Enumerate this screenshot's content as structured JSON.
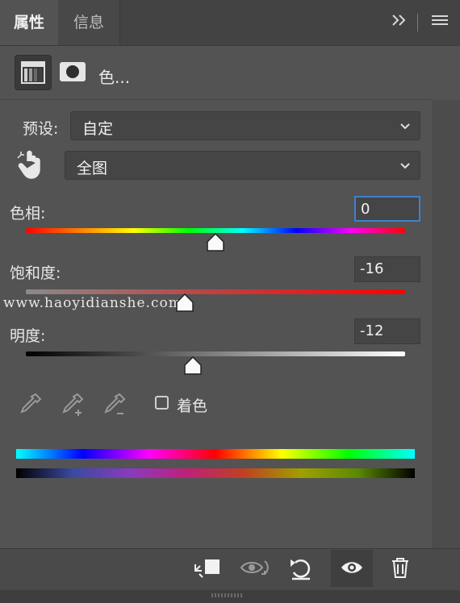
{
  "tabs": {
    "properties": "属性",
    "info": "信息"
  },
  "header": {
    "title": "色..."
  },
  "preset": {
    "label": "预设:",
    "value": "自定"
  },
  "range": {
    "value": "全图"
  },
  "hue": {
    "label": "色相:",
    "value": "0",
    "level": 0.5
  },
  "saturation": {
    "label": "饱和度:",
    "value": "-16",
    "level": 0.42
  },
  "lightness": {
    "label": "明度:",
    "value": "-12",
    "level": 0.44
  },
  "colorize": {
    "label": "着色",
    "checked": false
  },
  "watermark": "www.haoyidianshe.com"
}
